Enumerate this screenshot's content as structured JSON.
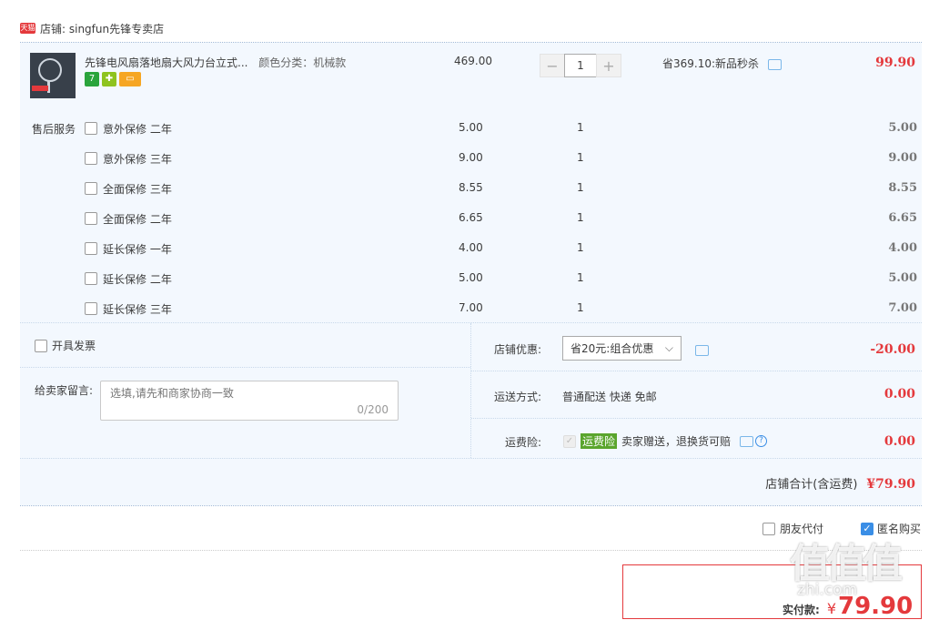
{
  "shop": {
    "badge": "天猫",
    "label": "店铺: singfun先锋专卖店"
  },
  "product": {
    "title": "先锋电风扇落地扇大风力台立式...",
    "sku": "颜色分类：机械款",
    "badges": [
      "7",
      "",
      ""
    ],
    "unit_price": "469.00",
    "quantity": "1",
    "minus": "−",
    "plus": "+",
    "promo": "省369.10:新品秒杀",
    "subtotal": "99.90"
  },
  "after_sales": {
    "label": "售后服务",
    "items": [
      {
        "name": "意外保修 二年",
        "price": "5.00",
        "qty": "1",
        "total": "5.00"
      },
      {
        "name": "意外保修 三年",
        "price": "9.00",
        "qty": "1",
        "total": "9.00"
      },
      {
        "name": "全面保修 三年",
        "price": "8.55",
        "qty": "1",
        "total": "8.55"
      },
      {
        "name": "全面保修 二年",
        "price": "6.65",
        "qty": "1",
        "total": "6.65"
      },
      {
        "name": "延长保修 一年",
        "price": "4.00",
        "qty": "1",
        "total": "4.00"
      },
      {
        "name": "延长保修 二年",
        "price": "5.00",
        "qty": "1",
        "total": "5.00"
      },
      {
        "name": "延长保修 三年",
        "price": "7.00",
        "qty": "1",
        "total": "7.00"
      }
    ]
  },
  "invoice": {
    "label": "开具发票"
  },
  "message": {
    "label": "给卖家留言:",
    "placeholder": "选填,请先和商家协商一致",
    "counter": "0/200"
  },
  "discount": {
    "label": "店铺优惠:",
    "selected": "省20元:组合优惠",
    "amount": "-20.00"
  },
  "shipping": {
    "label": "运送方式:",
    "value": "普通配送 快递 免邮",
    "amount": "0.00"
  },
  "insurance": {
    "label": "运费险:",
    "tag": "运费险",
    "desc": "卖家赠送，退换货可赔",
    "amount": "0.00"
  },
  "shop_total": {
    "label": "店铺合计(含运费)",
    "amount": "¥79.90"
  },
  "options": {
    "friend_pay": "朋友代付",
    "anonymous": "匿名购买"
  },
  "payment": {
    "label": "实付款:",
    "currency": "¥",
    "amount": "79.90"
  },
  "watermark": {
    "main": "值值值",
    "sub": "zhi.com"
  }
}
